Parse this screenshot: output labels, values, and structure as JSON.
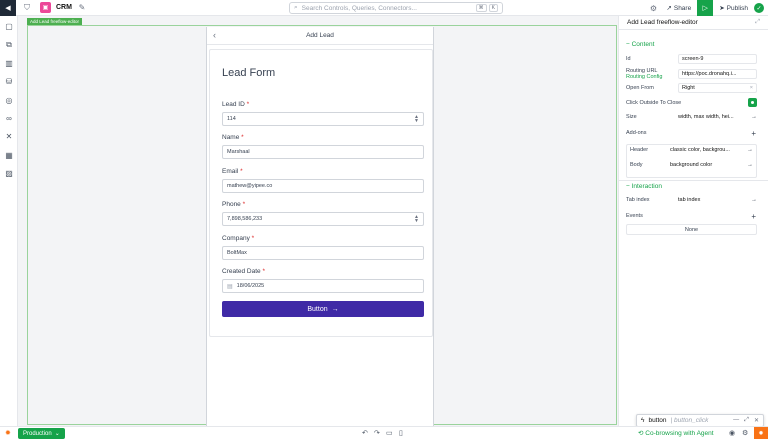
{
  "topbar": {
    "app_title": "CRM",
    "search_placeholder": "Search Controls, Queries, Connectors...",
    "search_keys": [
      "⌘",
      "K"
    ],
    "share_label": "Share",
    "publish_label": "Publish"
  },
  "canvas": {
    "badge": "Add Lead freeflow-editor",
    "frame_title": "Add Lead",
    "form_title": "Lead Form",
    "fields": [
      {
        "label": "Lead ID",
        "required": "*",
        "value": "114"
      },
      {
        "label": "Name",
        "required": "*",
        "value": "Marshaal"
      },
      {
        "label": "Email",
        "required": "*",
        "value": "mathew@yipee.co"
      },
      {
        "label": "Phone",
        "required": "*",
        "value": "7,898,586,233"
      },
      {
        "label": "Company",
        "required": "*",
        "value": "BoltMax"
      },
      {
        "label": "Created Date",
        "required": "*",
        "value": "18/06/2025"
      }
    ],
    "button_label": "Button"
  },
  "panel": {
    "title": "Add Lead freeflow-editor",
    "content_heading": "Content",
    "id_label": "Id",
    "id_value": "screen-9",
    "routing_label": "Routing URL",
    "routing_sublabel": "Routing Config",
    "routing_value": "https://poc.dronahq.i...",
    "open_from_label": "Open From",
    "open_from_value": "Right",
    "click_outside_label": "Click Outside To Close",
    "size_label": "Size",
    "size_value": "width, max width, hei...",
    "addons_label": "Add-ons",
    "header_label": "Header",
    "header_value": "classic color, backgrou...",
    "body_label": "Body",
    "body_value": "background color",
    "interaction_heading": "Interaction",
    "tab_index_label": "Tab index",
    "tab_index_value": "tab index",
    "events_label": "Events",
    "events_value": "None"
  },
  "bottombar": {
    "env_label": "Production",
    "cobrowse_label": "Co-browsing with Agent"
  },
  "popup": {
    "name": "button",
    "event": "button_click"
  },
  "colors": {
    "accent_green": "#16a34a",
    "button_purple": "#3f2aa6",
    "badge_green": "#4caf50"
  }
}
